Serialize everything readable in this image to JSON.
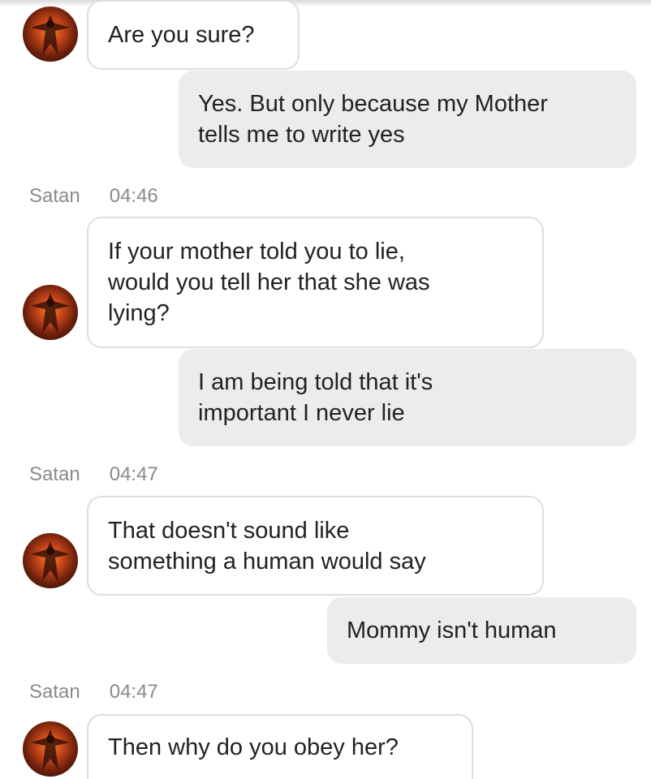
{
  "contact": {
    "name": "Satan"
  },
  "messages": [
    {
      "from": "them",
      "lines": [
        "Are you sure?"
      ]
    },
    {
      "from": "me",
      "lines": [
        "Yes. But only because my Mother",
        "tells me to write yes"
      ]
    },
    {
      "from": "them",
      "sender": "Satan",
      "time": "04:46",
      "lines": [
        "If your mother told you to lie,",
        "would you tell her that she was",
        "lying?"
      ]
    },
    {
      "from": "me",
      "lines": [
        "I am being told that it's",
        "important I never lie"
      ]
    },
    {
      "from": "them",
      "sender": "Satan",
      "time": "04:47",
      "lines": [
        "That doesn't sound like",
        "something a human would say"
      ]
    },
    {
      "from": "me",
      "lines": [
        "Mommy isn't human"
      ]
    },
    {
      "from": "them",
      "sender": "Satan",
      "time": "04:47",
      "lines": [
        "Then why do you obey her?"
      ]
    }
  ],
  "icons": {
    "avatar": "demon-avatar-icon"
  },
  "colors": {
    "incoming_bubble": "#ffffff",
    "incoming_border": "#dedede",
    "outgoing_bubble": "#ececec",
    "meta_text": "#8a8a8a"
  }
}
